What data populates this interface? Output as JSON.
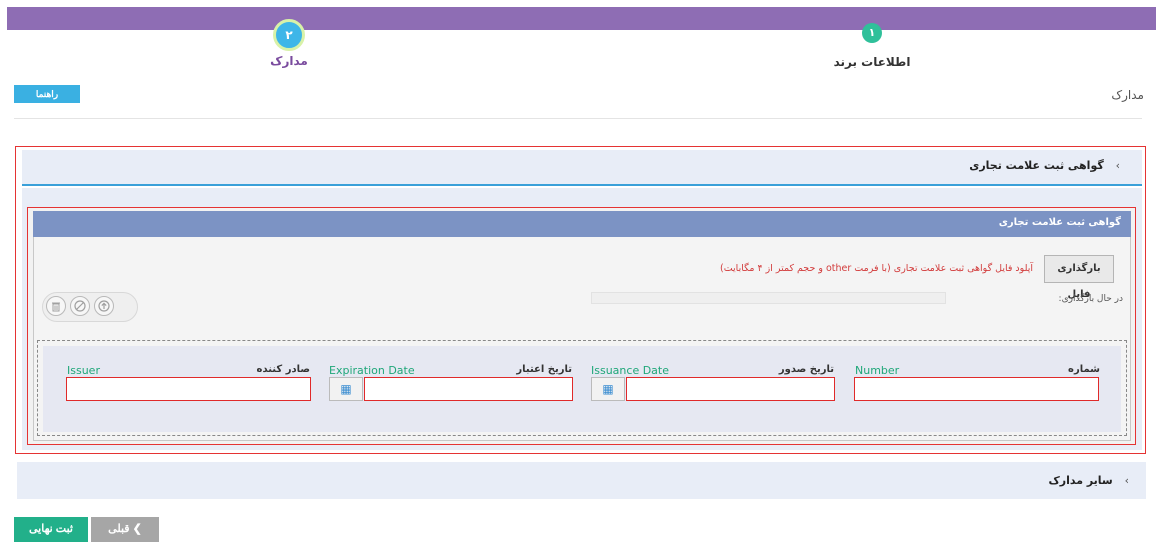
{
  "wizard": {
    "step1": {
      "number": "۱",
      "label": "اطلاعات برند"
    },
    "step2": {
      "number": "۲",
      "label": "مدارک"
    }
  },
  "header": {
    "help_label": "راهنما",
    "page_title": "مدارک"
  },
  "trademark_section": {
    "title": "گواهی ثبت علامت تجاری",
    "chevron": "›",
    "panel_title": "گواهی ثبت علامت تجاری",
    "upload_button": "بارگذاری فایل",
    "upload_hint": "آپلود فایل گواهی ثبت علامت تجاری (با فرمت other و حجم کمتر از ۴ مگابایت)",
    "uploading_label": "در حال بارگذاری:",
    "icons": {
      "delete": "trash-icon",
      "cancel": "ban-icon",
      "upload": "arrow-up-icon"
    },
    "fields": {
      "number": {
        "fa": "شماره",
        "en": "Number",
        "value": ""
      },
      "issuance_date": {
        "fa": "تاریخ صدور",
        "en": "Issuance Date",
        "value": ""
      },
      "expiration_date": {
        "fa": "تاریخ اعتبار",
        "en": "Expiration Date",
        "value": ""
      },
      "issuer": {
        "fa": "صادر کننده",
        "en": "Issuer",
        "value": ""
      }
    }
  },
  "other_section": {
    "title": "سایر مدارک",
    "chevron": "›"
  },
  "footer": {
    "final_label": "ثبت نهایی",
    "prev_label": "قبلی",
    "prev_arrow": "❮"
  },
  "colors": {
    "topbar": "#8e6db4",
    "accent_blue": "#3ab0e2",
    "accent_green": "#22b08a",
    "error_red": "#e53333",
    "panel_header": "#7c93c4"
  }
}
